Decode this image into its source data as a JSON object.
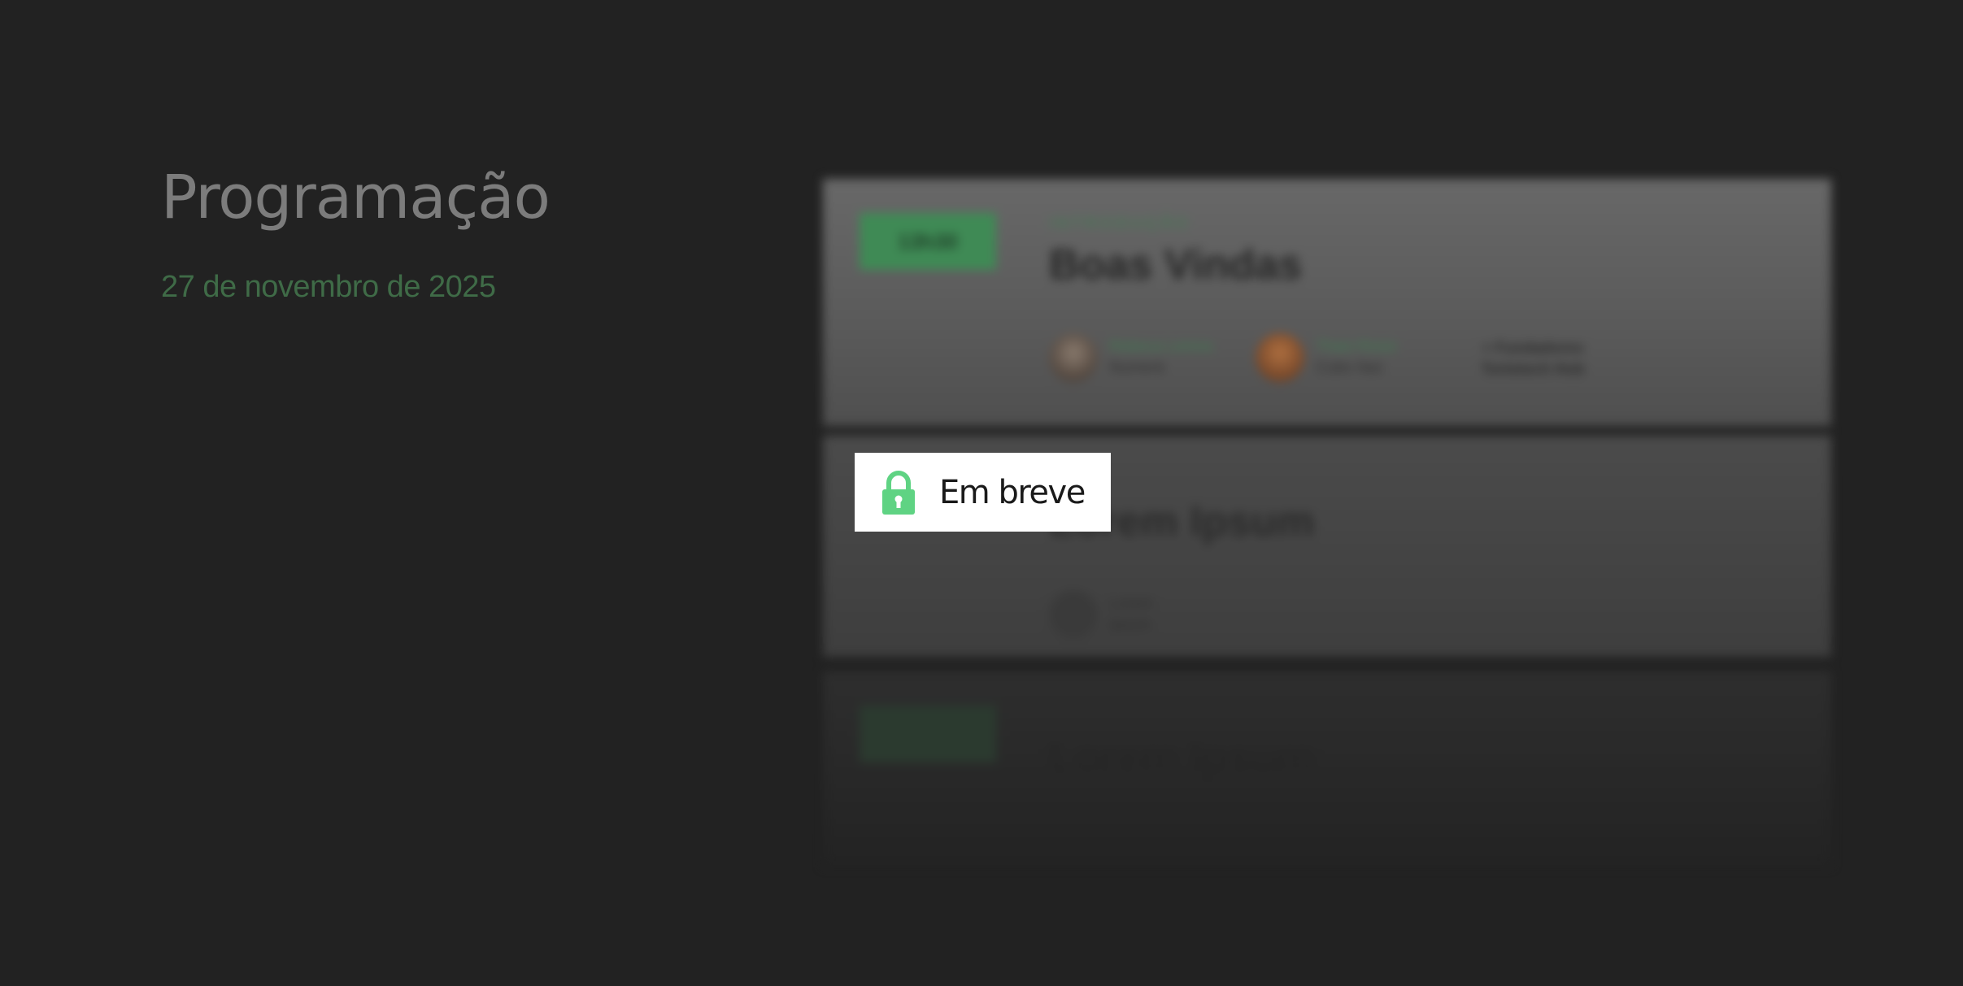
{
  "header": {
    "title": "Programação",
    "date": "27 de novembro de 2025"
  },
  "overlay": {
    "label": "Em breve",
    "icon": "lock-icon",
    "icon_color": "#5fd383"
  },
  "colors": {
    "background": "#222222",
    "accent_green": "#3f6b47",
    "badge_background": "#ffffff"
  },
  "schedule": {
    "items": [
      {
        "time": "13h30",
        "category": "INTRODUÇÃO",
        "title": "Boas Vindas",
        "speakers": [
          {
            "name": "Rebeca Lemos",
            "org": "Numerá"
          },
          {
            "name": "Thais Rossi",
            "org": "Cubo Itaú"
          }
        ],
        "note": "+ Fundadores Tortetech Hub"
      },
      {
        "time": "",
        "category": "",
        "title": "Lorem Ipsum",
        "speakers": [
          {
            "name": "Lorem",
            "org": "Ipsum"
          }
        ],
        "note": ""
      },
      {
        "time": "",
        "category": "",
        "title": "Lorem Ipsum",
        "speakers": [],
        "note": ""
      }
    ]
  }
}
